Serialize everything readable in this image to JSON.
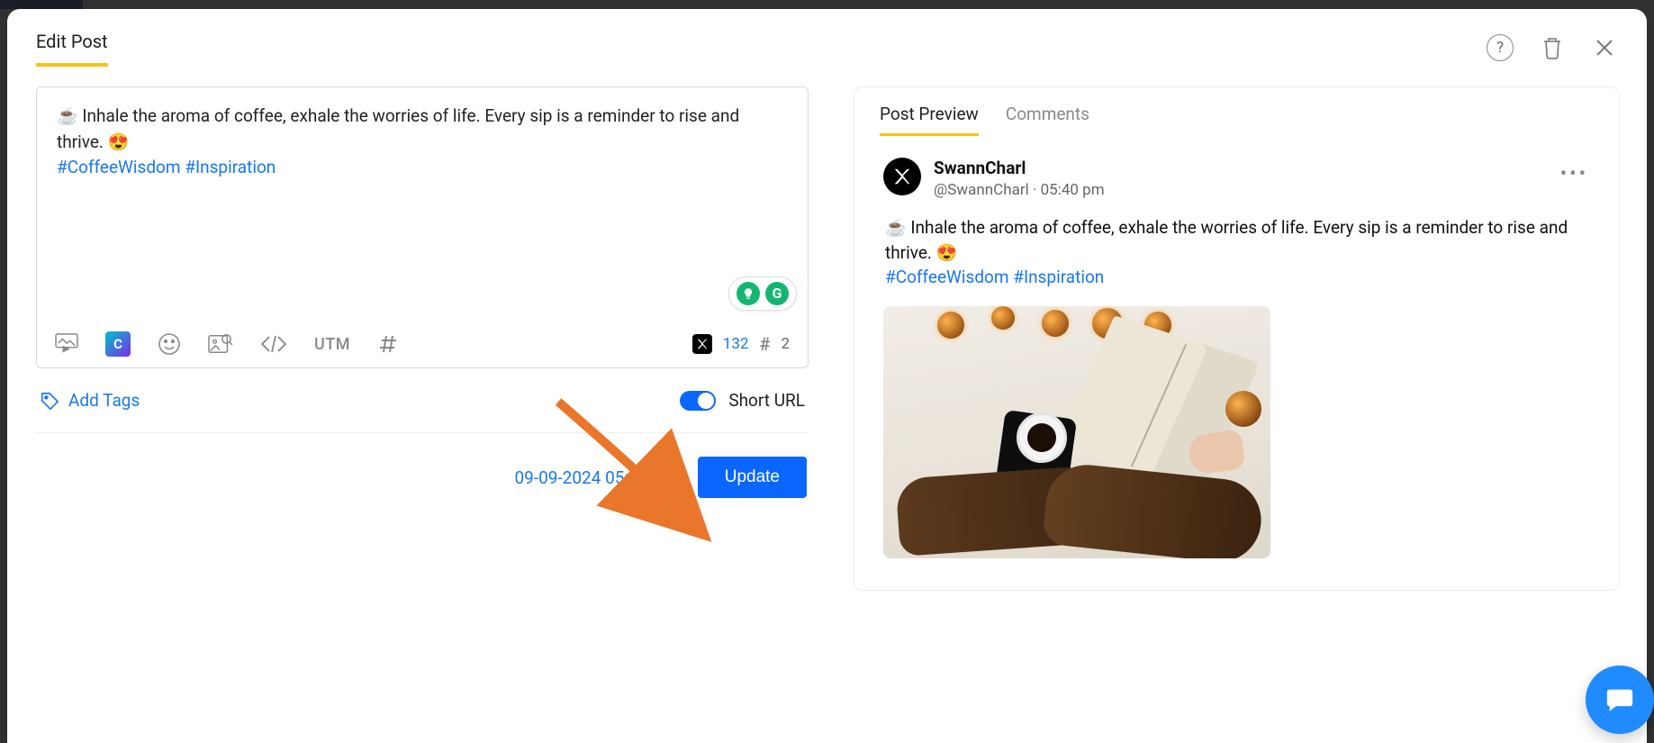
{
  "header": {
    "title": "Edit Post"
  },
  "composer": {
    "text_prefix": "☕ ",
    "text_body": "Inhale the aroma of coffee, exhale the worries of life. Every sip is a reminder to rise and thrive.  😍",
    "hashtags": "#CoffeeWisdom #Inspiration",
    "utm_label": "UTM",
    "char_count": "132",
    "hashtag_count": "2"
  },
  "tags": {
    "add_tags_label": "Add Tags",
    "short_url_label": "Short URL",
    "short_url_on": true
  },
  "schedule": {
    "datetime": "09-09-2024 05:18 PM",
    "update_label": "Update"
  },
  "preview_tabs": {
    "post_preview": "Post Preview",
    "comments": "Comments"
  },
  "preview": {
    "name": "SwannCharl",
    "handle_time": "@SwannCharl · 05:40 pm",
    "body_line1": "☕ Inhale the aroma of coffee, exhale the worries of life. Every sip is a reminder to rise and thrive. 😍",
    "hashtags": "#CoffeeWisdom #Inspiration"
  },
  "icons": {
    "canva": "C",
    "help": "?"
  }
}
